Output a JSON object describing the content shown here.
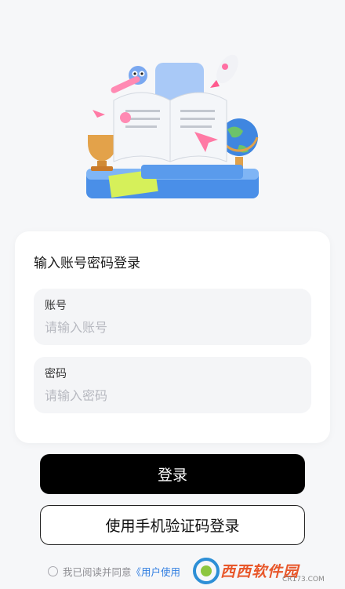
{
  "form": {
    "title": "输入账号密码登录",
    "account": {
      "label": "账号",
      "placeholder": "请输入账号"
    },
    "password": {
      "label": "密码",
      "placeholder": "请输入密码"
    }
  },
  "buttons": {
    "login": "登录",
    "sms_login": "使用手机验证码登录"
  },
  "agreement": {
    "prefix": "我已阅读并同意",
    "link": "《用户使用"
  },
  "watermark": {
    "brand": "西西软件园",
    "url": "CR173.COM"
  },
  "colors": {
    "primary_button": "#000000",
    "link": "#2f7de1",
    "card": "#ffffff",
    "background": "#f6f7f9"
  }
}
